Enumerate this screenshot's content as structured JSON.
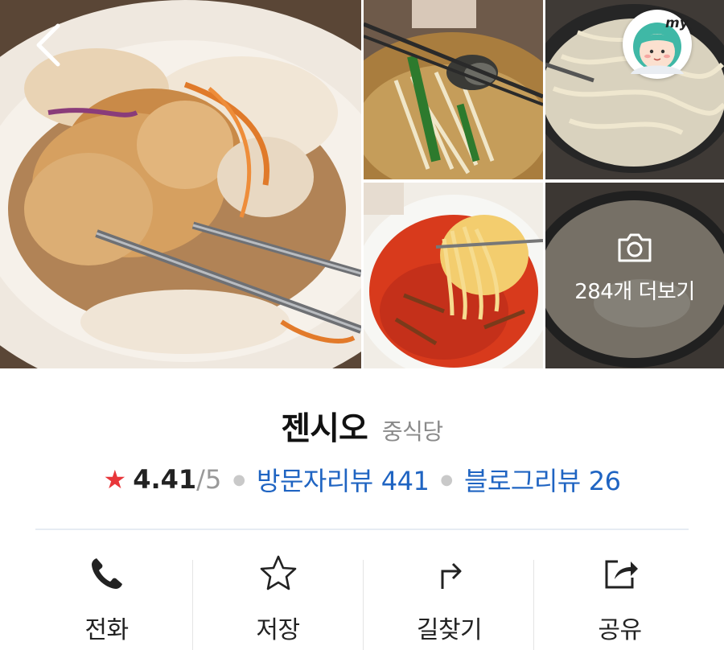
{
  "nav": {
    "back_icon": "chevron-left-icon",
    "profile_badge": "my"
  },
  "gallery": {
    "more_label": "284개 더보기",
    "camera_icon": "camera-icon"
  },
  "place": {
    "name": "젠시오",
    "category": "중식당",
    "rating": {
      "score": "4.41",
      "max": "/5"
    },
    "visitor_reviews": {
      "label": "방문자리뷰",
      "count": "441"
    },
    "blog_reviews": {
      "label": "블로그리뷰",
      "count": "26"
    }
  },
  "actions": [
    {
      "label": "전화",
      "icon": "phone-icon"
    },
    {
      "label": "저장",
      "icon": "star-outline-icon"
    },
    {
      "label": "길찾기",
      "icon": "directions-icon"
    },
    {
      "label": "공유",
      "icon": "share-icon"
    }
  ],
  "colors": {
    "accent_link": "#1f64c2",
    "rating_star": "#e8363a",
    "category_gray": "#8a8a8a"
  }
}
